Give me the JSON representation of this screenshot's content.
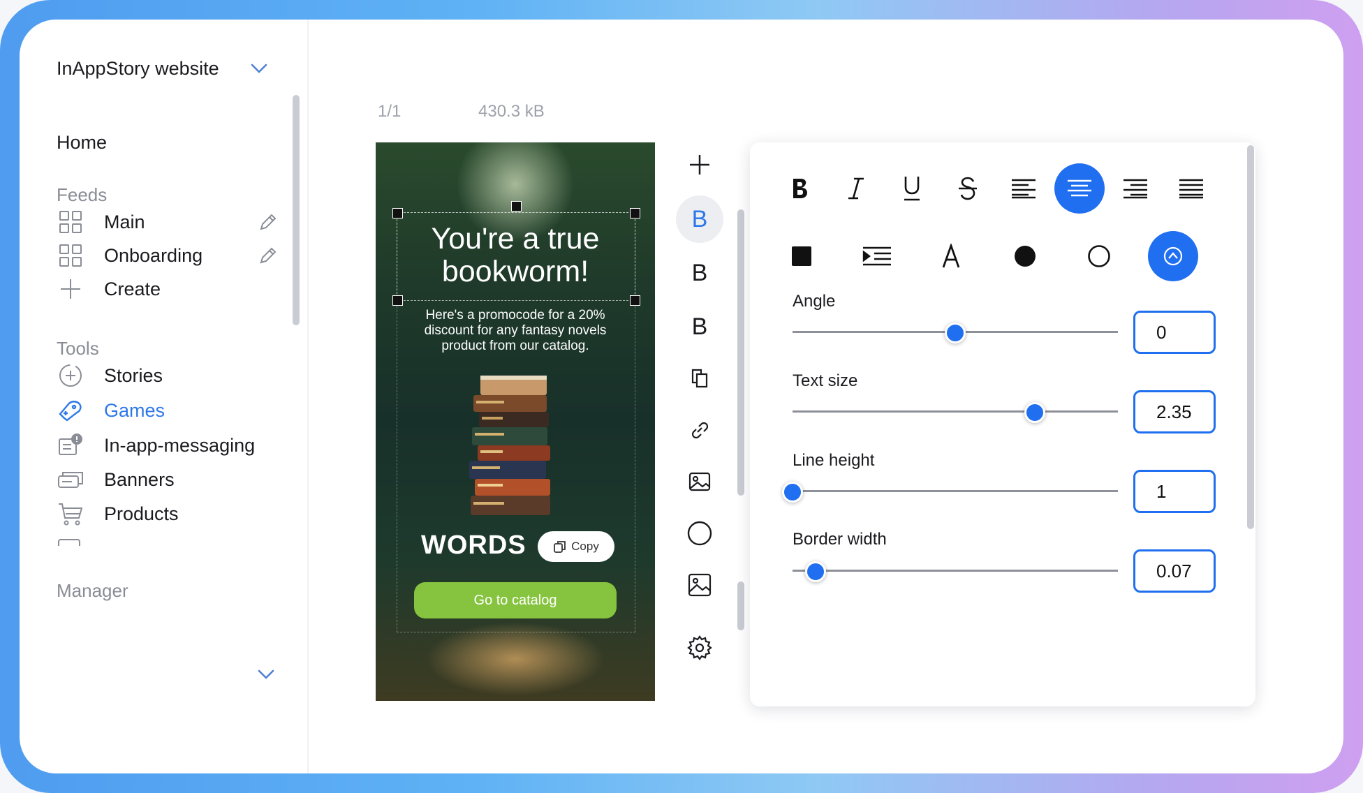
{
  "sidebar": {
    "workspace": "InAppStory website",
    "home": "Home",
    "feeds_heading": "Feeds",
    "feeds": [
      {
        "label": "Main",
        "icon": "grid-icon"
      },
      {
        "label": "Onboarding",
        "icon": "grid-icon"
      }
    ],
    "create": "Create",
    "tools_heading": "Tools",
    "tools": [
      {
        "label": "Stories",
        "icon": "stories-icon"
      },
      {
        "label": "Games",
        "icon": "gamepad-icon",
        "active": true
      },
      {
        "label": "In-app-messaging",
        "icon": "message-icon"
      },
      {
        "label": "Banners",
        "icon": "banner-icon"
      },
      {
        "label": "Products",
        "icon": "cart-icon"
      }
    ],
    "manager_heading": "Manager"
  },
  "editor": {
    "page_counter": "1/1",
    "file_size": "430.3 kB"
  },
  "story": {
    "title": "You're a true bookworm!",
    "subtitle": "Here's a promocode for a 20% discount for any fantasy novels product from our catalog.",
    "promo_code": "WORDS",
    "copy_label": "Copy",
    "cta_label": "Go to catalog"
  },
  "toolbar": {
    "add": "add-icon",
    "text_tools": [
      "B",
      "B",
      "B"
    ],
    "icons": [
      "copy-icon",
      "link-icon",
      "image-icon",
      "circle-icon",
      "picture-icon",
      "gear-icon"
    ]
  },
  "properties": {
    "format_row1": [
      "bold",
      "italic",
      "underline",
      "strikethrough",
      "align-left",
      "align-center",
      "align-right",
      "justify"
    ],
    "format_row1_active": "align-center",
    "format_row2": [
      "fill-color",
      "indent",
      "font",
      "filled-circle",
      "outline-circle",
      "gradient"
    ],
    "sliders": [
      {
        "label": "Angle",
        "value": "0",
        "fraction": 0.5
      },
      {
        "label": "Text size",
        "value": "2.35",
        "fraction": 0.745
      },
      {
        "label": "Line height",
        "value": "1",
        "fraction": 0.0
      },
      {
        "label": "Border width",
        "value": "0.07",
        "fraction": 0.07
      }
    ]
  },
  "colors": {
    "accent": "#1f6ff0",
    "active_nav": "#2f78e8",
    "cta": "#86c43f"
  }
}
